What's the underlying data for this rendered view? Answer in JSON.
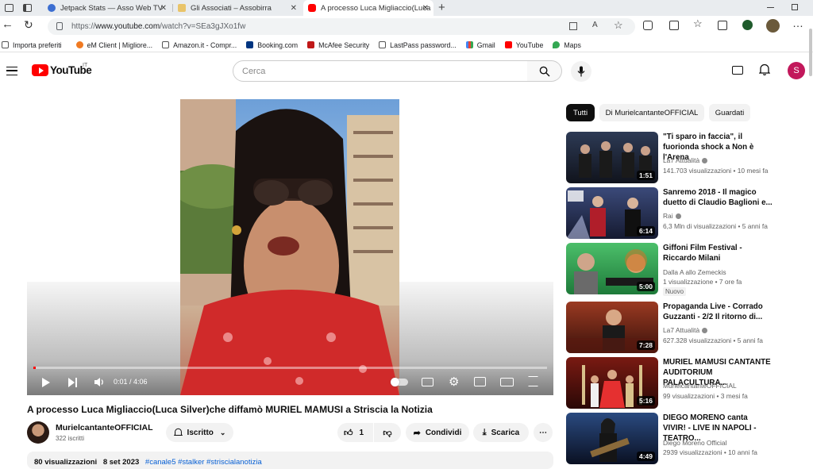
{
  "browser": {
    "tabs": [
      {
        "title": "Jetpack Stats — Asso Web TV",
        "icon_color": "#3c6ed1"
      },
      {
        "title": "Gli Associati – Assobirra",
        "icon_color": "#e9c46a"
      },
      {
        "title": "A processo Luca Migliaccio(Luca",
        "icon_color": "#ff0000"
      }
    ],
    "url_prefix": "https://",
    "url_host": "www.youtube.com",
    "url_path": "/watch?v=SEa3gJXo1fw",
    "bookmarks": [
      {
        "label": "Importa preferiti",
        "icon": "import-icon"
      },
      {
        "label": "eM Client | Migliore...",
        "icon": "emclient-icon"
      },
      {
        "label": "Amazon.it - Compr...",
        "icon": "page-icon"
      },
      {
        "label": "Booking.com",
        "icon": "booking-icon"
      },
      {
        "label": "McAfee Security",
        "icon": "mcafee-icon"
      },
      {
        "label": "LastPass password...",
        "icon": "page-icon"
      },
      {
        "label": "Gmail",
        "icon": "gmail-icon"
      },
      {
        "label": "YouTube",
        "icon": "youtube-icon"
      },
      {
        "label": "Maps",
        "icon": "maps-icon"
      }
    ]
  },
  "youtube": {
    "logo": "YouTube",
    "country": "IT",
    "search_placeholder": "Cerca",
    "avatar_letter": "S",
    "player": {
      "time": "0:01 / 4:06",
      "progress": 0.004
    },
    "video": {
      "title": "A processo Luca Migliaccio(Luca Silver)che diffamò MURIEL MAMUSI a Striscia la Notizia",
      "channel": "MurielcantanteOFFICIAL",
      "subscribers": "322 iscritti",
      "subscribe_label": "Iscritto",
      "likes": "1",
      "share_label": "Condividi",
      "download_label": "Scarica",
      "views": "80 visualizzazioni",
      "date": "8 set 2023",
      "hashtags": "#canale5 #stalker #striscialanotizia"
    },
    "chips": [
      "Tutti",
      "Di MurielcantanteOFFICIAL",
      "Guardati"
    ],
    "recommendations": [
      {
        "title": "\"Ti sparo in faccia\", il fuorionda shock a Non è l'Arena",
        "channel": "La7 Attualità",
        "verified": true,
        "meta": "141.703 visualizzazioni • 10 mesi fa",
        "duration": "1:51",
        "thumb_color": "#1b1f2e"
      },
      {
        "title": "Sanremo 2018 - Il magico duetto di Claudio Baglioni e...",
        "channel": "Rai",
        "verified": true,
        "meta": "6,3 Mln di visualizzazioni • 5 anni fa",
        "duration": "6:14",
        "thumb_color": "#2a3150"
      },
      {
        "title": "Giffoni Film Festival - Riccardo Milani",
        "channel": "Dalla A allo Zemeckis",
        "verified": false,
        "meta": "1 visualizzazione • 7 ore fa",
        "badge": "Nuovo",
        "duration": "5:00",
        "thumb_color": "#3aa35a"
      },
      {
        "title": "Propaganda Live - Corrado Guzzanti - 2/2 Il ritorno di...",
        "channel": "La7 Attualità",
        "verified": true,
        "meta": "627.328 visualizzazioni • 5 anni fa",
        "duration": "7:28",
        "thumb_color": "#7a2a1c"
      },
      {
        "title": "MURIEL MAMUSI CANTANTE AUDITORIUM PALACULTURA...",
        "channel": "MurielcantanteOFFICIAL",
        "verified": false,
        "meta": "99 visualizzazioni • 3 mesi fa",
        "duration": "5:16",
        "thumb_color": "#5a1410"
      },
      {
        "title": "DIEGO MORENO canta VIVIR! - LIVE IN NAPOLI - TEATRO...",
        "channel": "Diego Moreno Official",
        "verified": false,
        "meta": "2939 visualizzazioni • 10 anni fa",
        "duration": "4:49",
        "thumb_color": "#12203a"
      }
    ]
  }
}
